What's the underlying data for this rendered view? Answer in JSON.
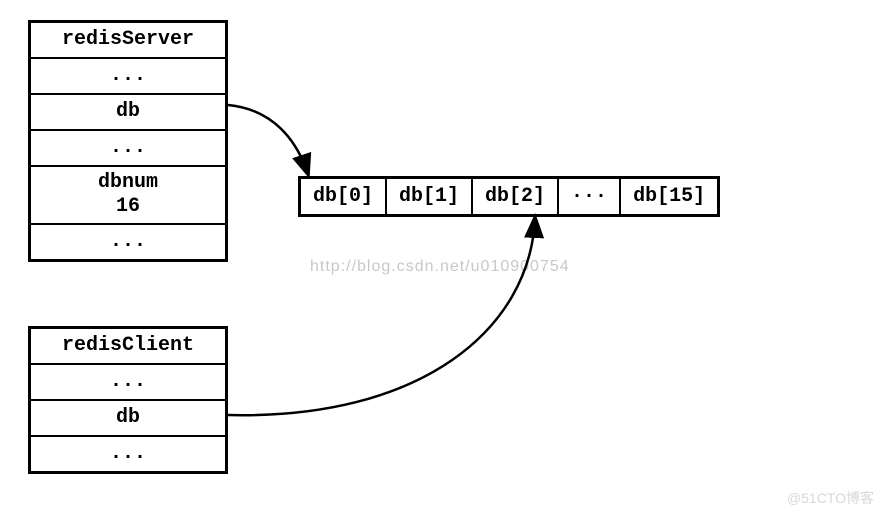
{
  "server": {
    "title": "redisServer",
    "rows": [
      "...",
      "db",
      "...",
      "dbnum\n16",
      "..."
    ]
  },
  "client": {
    "title": "redisClient",
    "rows": [
      "...",
      "db",
      "..."
    ]
  },
  "db_array": {
    "cells": [
      "db[0]",
      "db[1]",
      "db[2]",
      "···",
      "db[15]"
    ]
  },
  "watermarks": {
    "csdn": "http://blog.csdn.net/u010900754",
    "cto": "@51CTO博客"
  }
}
